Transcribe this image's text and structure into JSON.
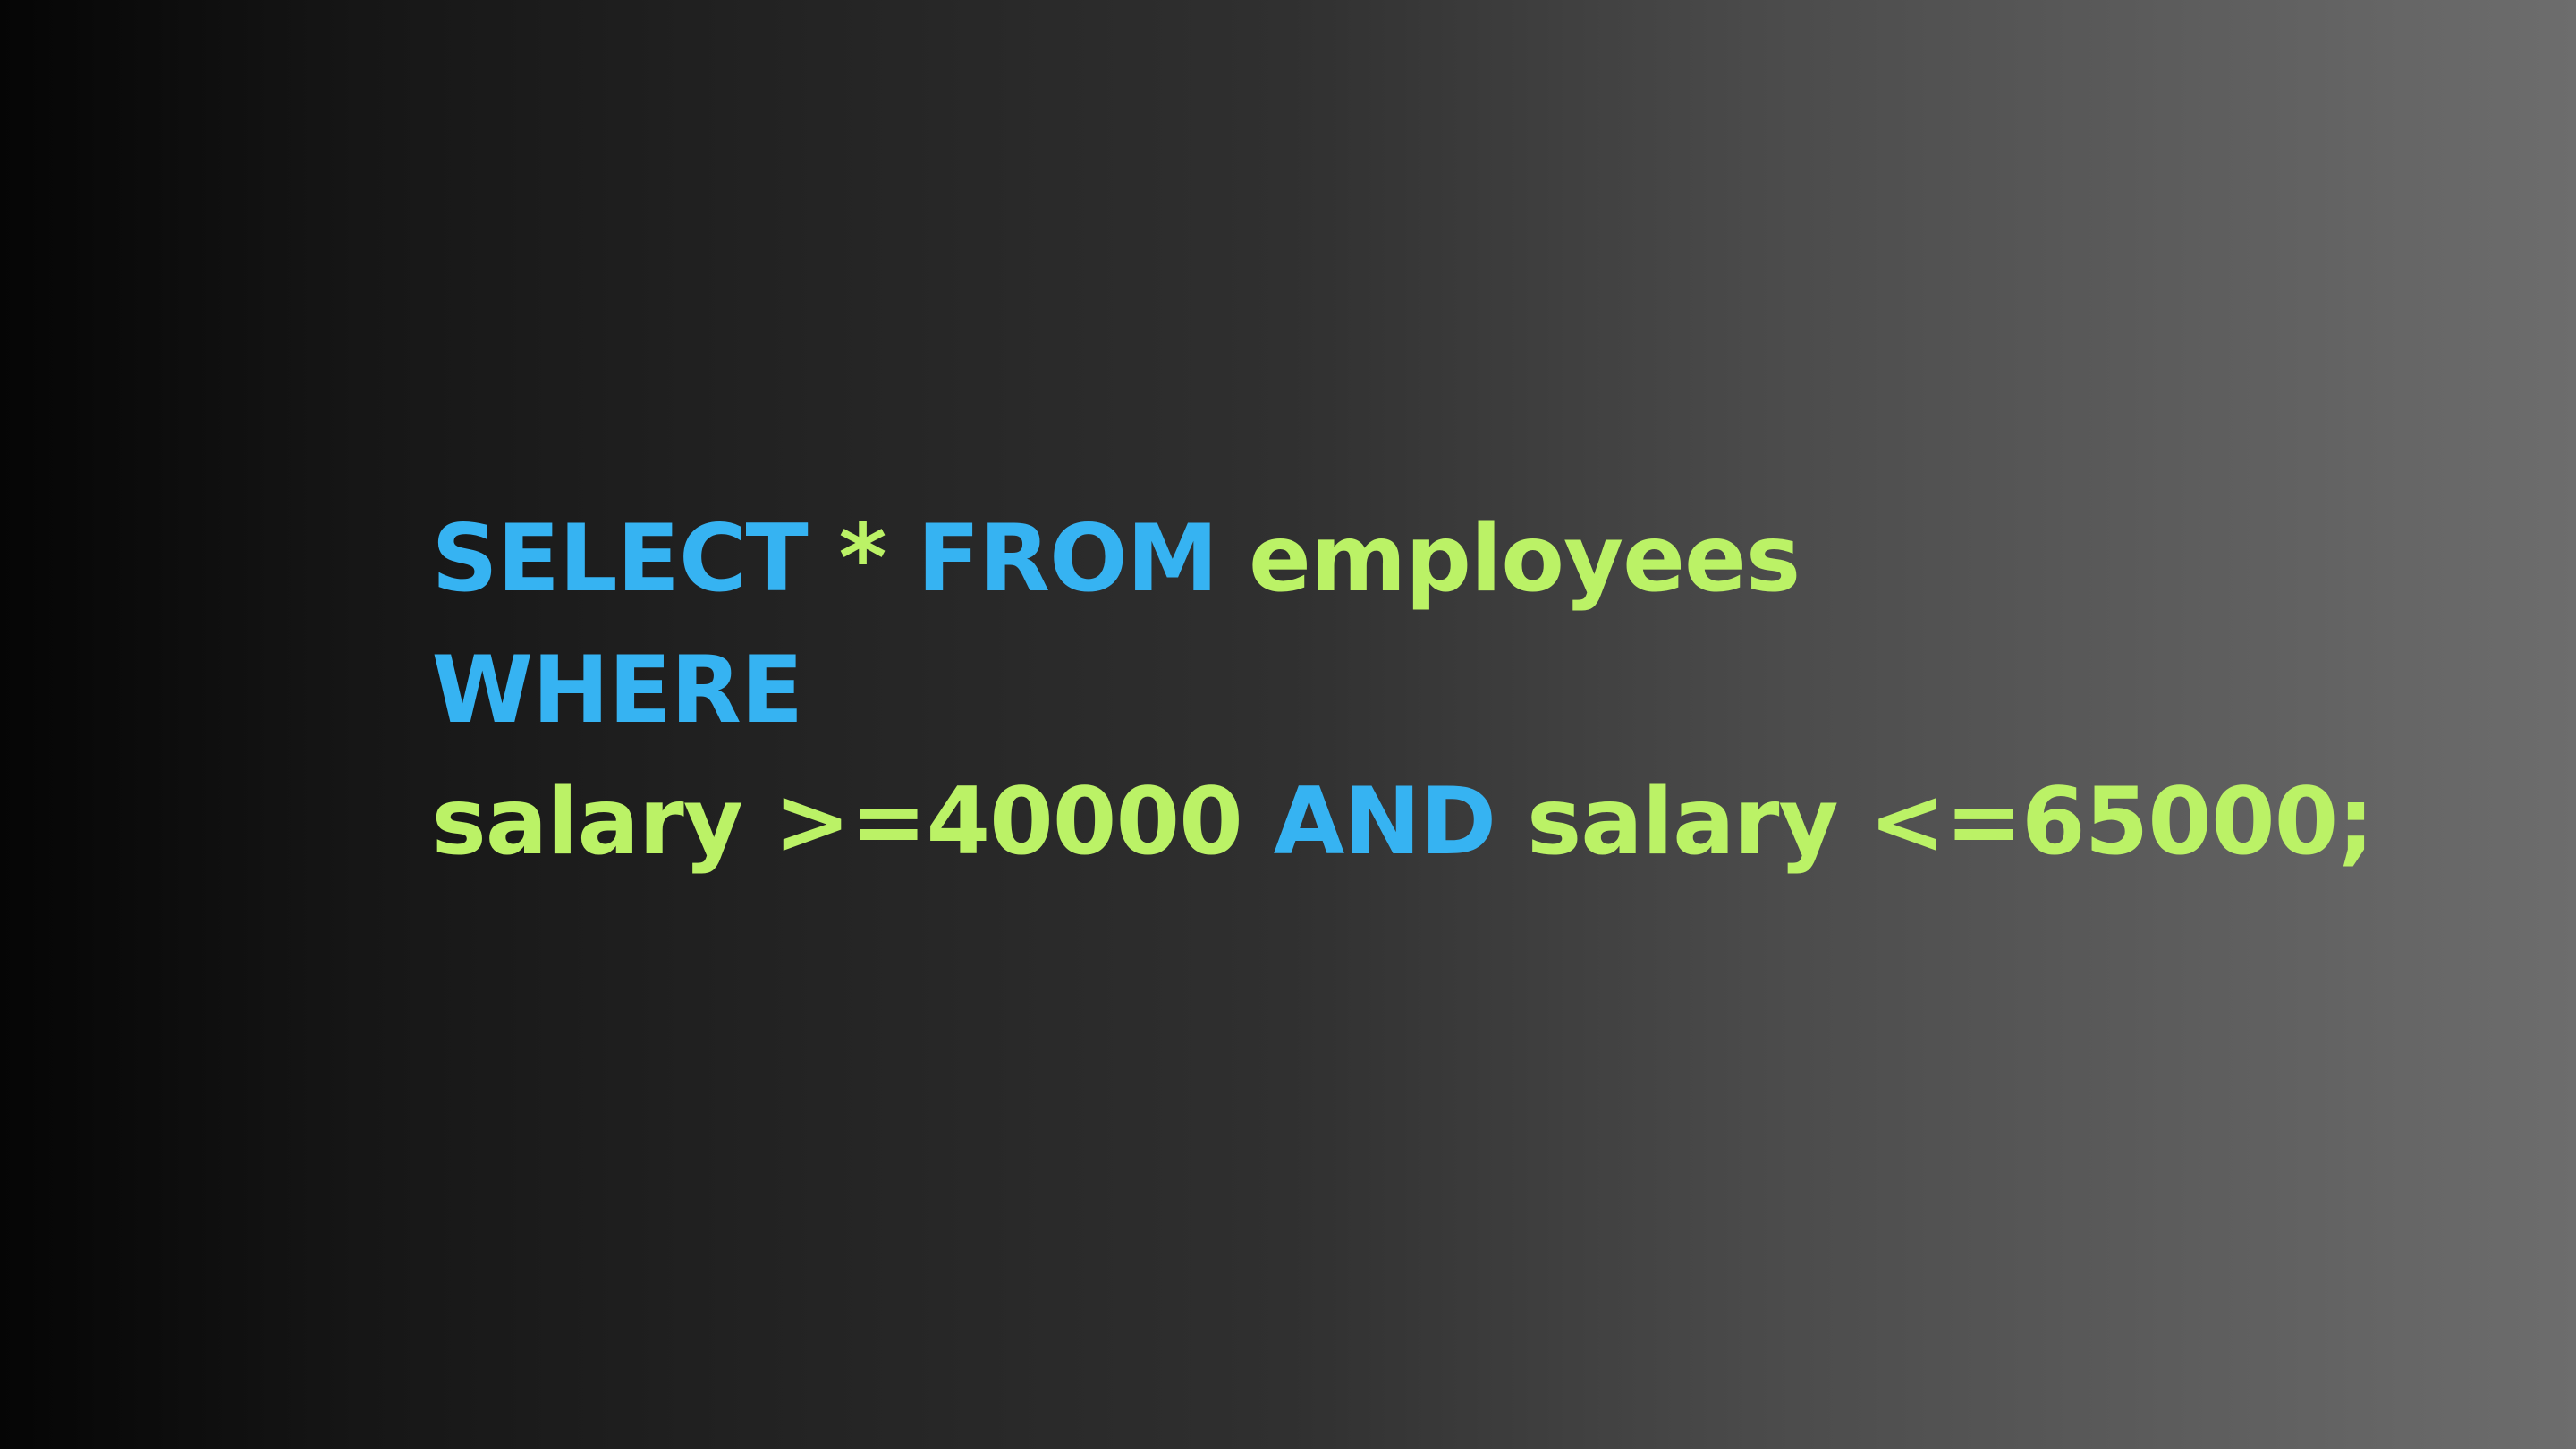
{
  "colors": {
    "keyword": "#36b3f2",
    "identifier": "#bbf266",
    "background_start": "#050505",
    "background_end": "#6d6d6d"
  },
  "lines": [
    [
      {
        "text": "SELECT",
        "kind": "keyword"
      },
      {
        "text": " * ",
        "kind": "identifier"
      },
      {
        "text": "FROM",
        "kind": "keyword"
      },
      {
        "text": " employees",
        "kind": "identifier"
      }
    ],
    [
      {
        "text": "WHERE",
        "kind": "keyword"
      }
    ],
    [
      {
        "text": "salary >=40000 ",
        "kind": "identifier"
      },
      {
        "text": "AND",
        "kind": "keyword"
      },
      {
        "text": " salary <=65000;",
        "kind": "identifier"
      }
    ]
  ]
}
